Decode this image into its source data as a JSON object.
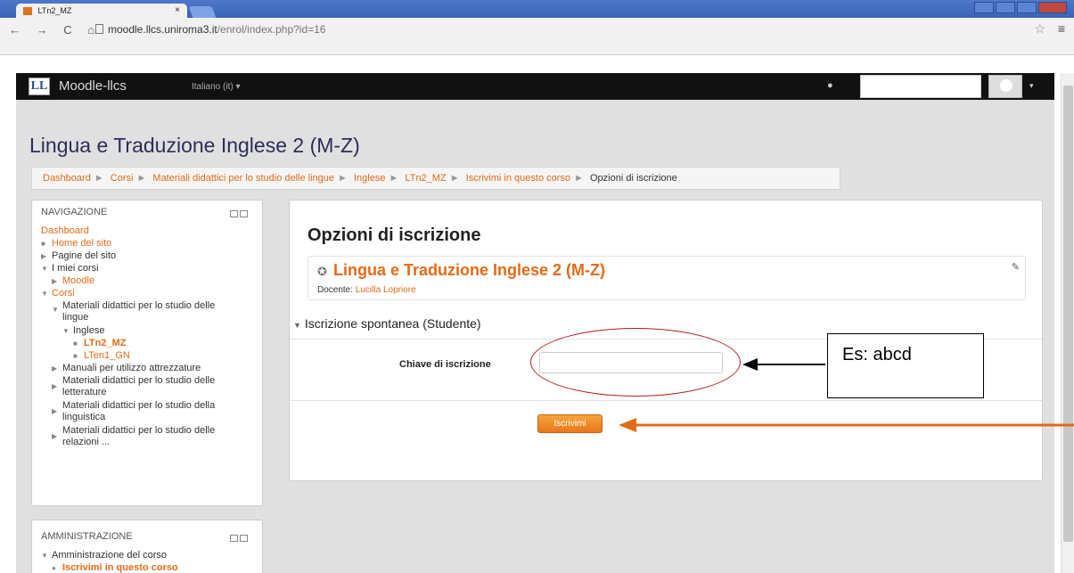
{
  "browser": {
    "tab_title": "LTn2_MZ",
    "tab_close": "×",
    "url_host": "moodle.llcs.uniroma3.it",
    "url_path": "/enrol/index.php?id=16",
    "nav_glyphs": "← → C ⌂",
    "star_glyph": "☆",
    "menu_glyph": "≡"
  },
  "moodle_nav": {
    "logo_text": "LL",
    "brand": "Moodle-llcs",
    "language": "Italiano (it) ▾",
    "caret": "▾"
  },
  "course_title": "Lingua e Traduzione Inglese 2 (M-Z)",
  "breadcrumb": [
    "Dashboard",
    "Corsi",
    "Materiali didattici per lo studio delle lingue",
    "Inglese",
    "LTn2_MZ",
    "Iscrivimi in questo corso",
    "Opzioni di iscrizione"
  ],
  "navigation_block": {
    "title": "NAVIGAZIONE",
    "items": [
      {
        "label": "Dashboard"
      },
      {
        "label": "Home del sito"
      },
      {
        "label": "Pagine del sito"
      },
      {
        "label": "I miei corsi"
      },
      {
        "label": "Moodle"
      },
      {
        "label": "Corsi"
      },
      {
        "label": "Materiali didattici per lo studio delle lingue"
      },
      {
        "label": "Inglese"
      },
      {
        "label": "LTn2_MZ"
      },
      {
        "label": "LTen1_GN"
      },
      {
        "label": "Manuali per utilizzo attrezzature"
      },
      {
        "label": "Materiali didattici per lo studio delle letterature"
      },
      {
        "label": "Materiali didattici per lo studio della linguistica"
      },
      {
        "label": "Materiali didattici per lo studio delle relazioni ..."
      }
    ]
  },
  "admin_block": {
    "title": "AMMINISTRAZIONE",
    "items": [
      {
        "label": "Amministrazione del corso"
      },
      {
        "label": "Iscrivimi in questo corso"
      }
    ]
  },
  "main": {
    "heading": "Opzioni di iscrizione",
    "course_name": "Lingua e Traduzione Inglese 2 (M-Z)",
    "teacher_label": "Docente:",
    "teacher_name": "Lucilla Lopriore",
    "section_title": "Iscrizione spontanea (Studente)",
    "key_label": "Chiave di iscrizione",
    "key_value": "",
    "submit_label": "Iscrivimi"
  },
  "annotation": {
    "note_text": "Es:  abcd",
    "ellipse_color": "#b01c1c",
    "arrow_black": "#000000",
    "arrow_orange": "#e06c18"
  },
  "colors": {
    "link_orange": "#e46a17",
    "navbar_dark": "#111111",
    "title_color": "#2d2d5a"
  }
}
